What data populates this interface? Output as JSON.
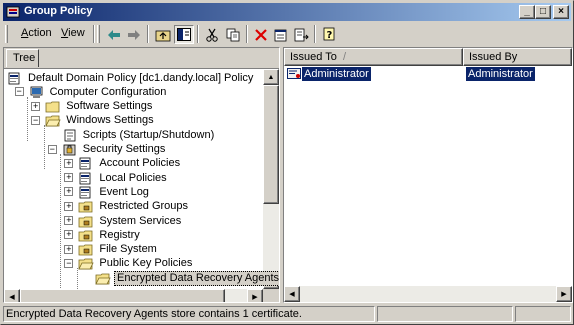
{
  "window": {
    "title": "Group Policy",
    "controls": {
      "minimize": "_",
      "maximize": "□",
      "close": "×"
    }
  },
  "menu": [
    {
      "label": "Action",
      "accel": "A",
      "rest": "ction"
    },
    {
      "label": "View",
      "accel": "V",
      "rest": "iew"
    }
  ],
  "toolbar_icons": [
    "back-arrow-icon",
    "forward-arrow-icon",
    "up-folder-icon",
    "show-hide-tree-icon",
    "cut-icon",
    "copy-icon",
    "delete-icon",
    "properties-icon",
    "export-list-icon",
    "help-icon"
  ],
  "tree": {
    "tab_label": "Tree",
    "nodes": [
      {
        "label": "Default Domain Policy [dc1.dandy.local] Policy",
        "icon": "policy-icon",
        "level": 0
      },
      {
        "label": "Computer Configuration",
        "icon": "computer-icon",
        "level": 1,
        "expander": "-"
      },
      {
        "label": "Software Settings",
        "icon": "folder-icon",
        "level": 2,
        "expander": "+"
      },
      {
        "label": "Windows Settings",
        "icon": "folder-open-icon",
        "level": 2,
        "expander": "-"
      },
      {
        "label": "Scripts (Startup/Shutdown)",
        "icon": "script-icon",
        "level": 3
      },
      {
        "label": "Security Settings",
        "icon": "security-icon",
        "level": 3,
        "expander": "-"
      },
      {
        "label": "Account Policies",
        "icon": "policy-icon",
        "level": 4,
        "expander": "+"
      },
      {
        "label": "Local Policies",
        "icon": "policy-icon",
        "level": 4,
        "expander": "+"
      },
      {
        "label": "Event Log",
        "icon": "policy-icon",
        "level": 4,
        "expander": "+"
      },
      {
        "label": "Restricted Groups",
        "icon": "folder-lock-icon",
        "level": 4,
        "expander": "+"
      },
      {
        "label": "System Services",
        "icon": "folder-lock-icon",
        "level": 4,
        "expander": "+"
      },
      {
        "label": "Registry",
        "icon": "folder-lock-icon",
        "level": 4,
        "expander": "+"
      },
      {
        "label": "File System",
        "icon": "folder-lock-icon",
        "level": 4,
        "expander": "+"
      },
      {
        "label": "Public Key Policies",
        "icon": "folder-open-icon",
        "level": 4,
        "expander": "-"
      },
      {
        "label": "Encrypted Data Recovery Agents",
        "icon": "folder-open-icon",
        "level": 5,
        "selected": true
      }
    ]
  },
  "list": {
    "columns": [
      "Issued To",
      "Issued By"
    ],
    "sort_indicator": "/",
    "rows": [
      {
        "issued_to": "Administrator",
        "issued_by": "Administrator",
        "icon": "certificate-icon"
      }
    ]
  },
  "status": {
    "text": "Encrypted Data Recovery Agents store contains 1 certificate."
  },
  "colors": {
    "title_bar_start": "#0a246a",
    "title_bar_end": "#a6caf0",
    "selection": "#0a246a",
    "face": "#d4d0c8"
  }
}
